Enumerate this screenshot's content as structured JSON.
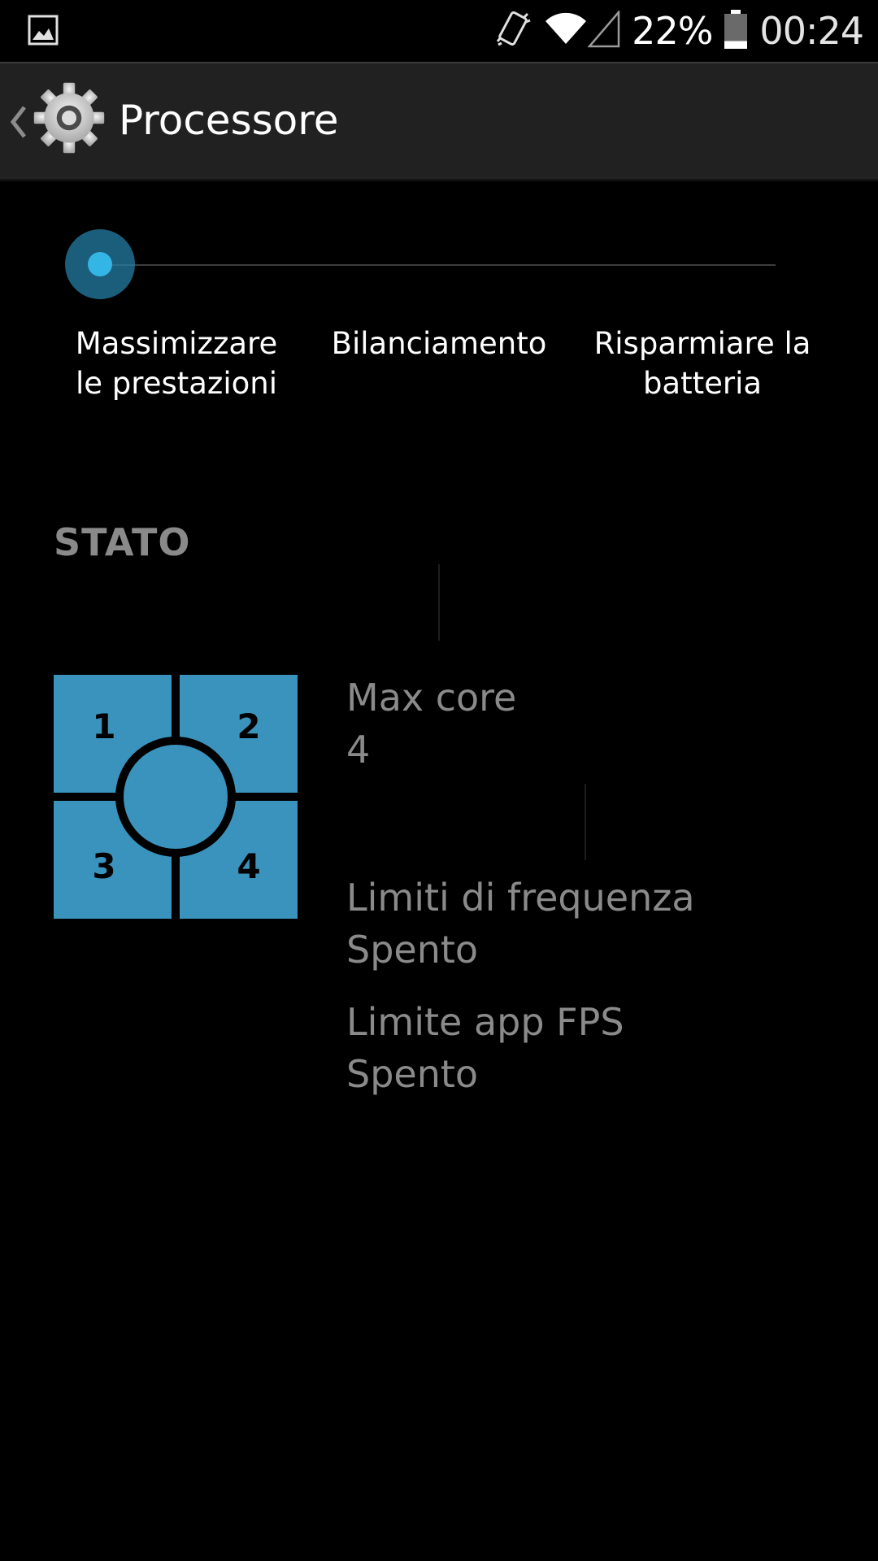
{
  "status_bar": {
    "icons": [
      "gallery-notification-icon",
      "vibrate-icon",
      "wifi-icon",
      "signal-icon",
      "battery-icon"
    ],
    "battery_percent": "22%",
    "battery_level": 0.22,
    "time": "00:24"
  },
  "action_bar": {
    "title": "Processore",
    "icon": "gear-icon"
  },
  "modes": {
    "selected_index": 0,
    "options": [
      {
        "label_line1": "Massimizzare",
        "label_line2": "le prestazioni"
      },
      {
        "label_line1": "Bilanciamento",
        "label_line2": ""
      },
      {
        "label_line1": "Risparmiare la",
        "label_line2": "batteria"
      }
    ]
  },
  "status": {
    "header": "STATO",
    "cores_graphic": [
      "1",
      "2",
      "3",
      "4"
    ],
    "items": [
      {
        "title": "Max core",
        "value": "4"
      },
      {
        "title": "Limiti di frequenza",
        "value": "Spento"
      },
      {
        "title": "Limite app FPS",
        "value": "Spento"
      }
    ]
  },
  "colors": {
    "accent": "#33b5e5",
    "core_tile": "#3a93bd",
    "secondary_text": "#8a8a8a",
    "action_bar": "#212121"
  }
}
